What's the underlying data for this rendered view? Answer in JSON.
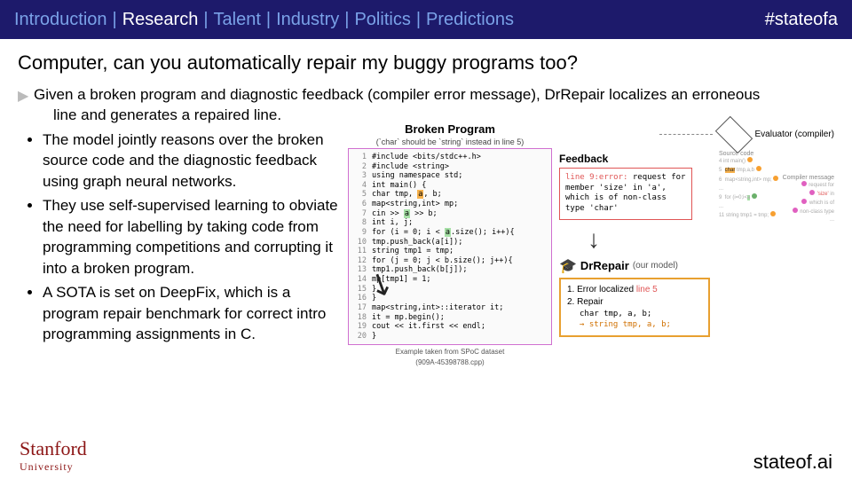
{
  "nav": {
    "items": [
      "Introduction",
      "Research",
      "Talent",
      "Industry",
      "Politics",
      "Predictions"
    ],
    "active": 1,
    "hashtag": "#stateofa"
  },
  "title": "Computer, can you automatically repair my buggy programs too?",
  "intro": "Given a broken program and diagnostic feedback (compiler error message), DrRepair localizes an erroneous",
  "intro2": "line and generates a repaired line.",
  "bullets": [
    "The model jointly reasons over the broken source code and the diagnostic feedback using graph neural networks.",
    "They use self-supervised learning to obviate the need for labelling by taking code from programming competitions and corrupting it into a broken program.",
    "A SOTA is set on DeepFix, which is a program repair benchmark for correct intro programming assignments in C."
  ],
  "figure": {
    "broken_title": "Broken Program",
    "hint": "(`char` should be `string` instead in line 5)",
    "code": [
      "#include <bits/stdc++.h>",
      "#include <string>",
      "using namespace std;",
      "int main() {",
      "  char tmp, a, b;",
      "  map<string,int> mp;",
      "  cin >> a >> b;",
      "  int i, j;",
      "  for (i = 0; i < a.size(); i++){",
      "    tmp.push_back(a[i]);",
      "    string tmp1 = tmp;",
      "    for (j = 0; j < b.size(); j++){",
      "      tmp1.push_back(b[j]);",
      "      mp[tmp1] = 1;",
      "    }",
      "  }",
      "  map<string,int>::iterator it;",
      "  it = mp.begin();",
      "  cout << it.first << endl;",
      "}"
    ],
    "example_note1": "Example taken from SPoC dataset",
    "example_note2": "(909A-45398788.cpp)",
    "evaluator": "Evaluator (compiler)",
    "feedback_title": "Feedback",
    "feedback_lines": [
      "line 9:error:",
      " request for",
      "member 'size' in 'a',",
      "which is of non-class",
      "type 'char'"
    ],
    "model_name": "DrRepair",
    "our_model": "(our model)",
    "result_1": "1. Error localized ",
    "result_1_loc": "line 5",
    "result_2": "2. Repair",
    "result_old": "char tmp, a, b;",
    "result_new": "→  string tmp, a, b;",
    "src_title": "Source code",
    "cmp_title": "Compiler message"
  },
  "footer": {
    "stanford1": "Stanford",
    "stanford2": "University",
    "right": "stateof.ai"
  }
}
